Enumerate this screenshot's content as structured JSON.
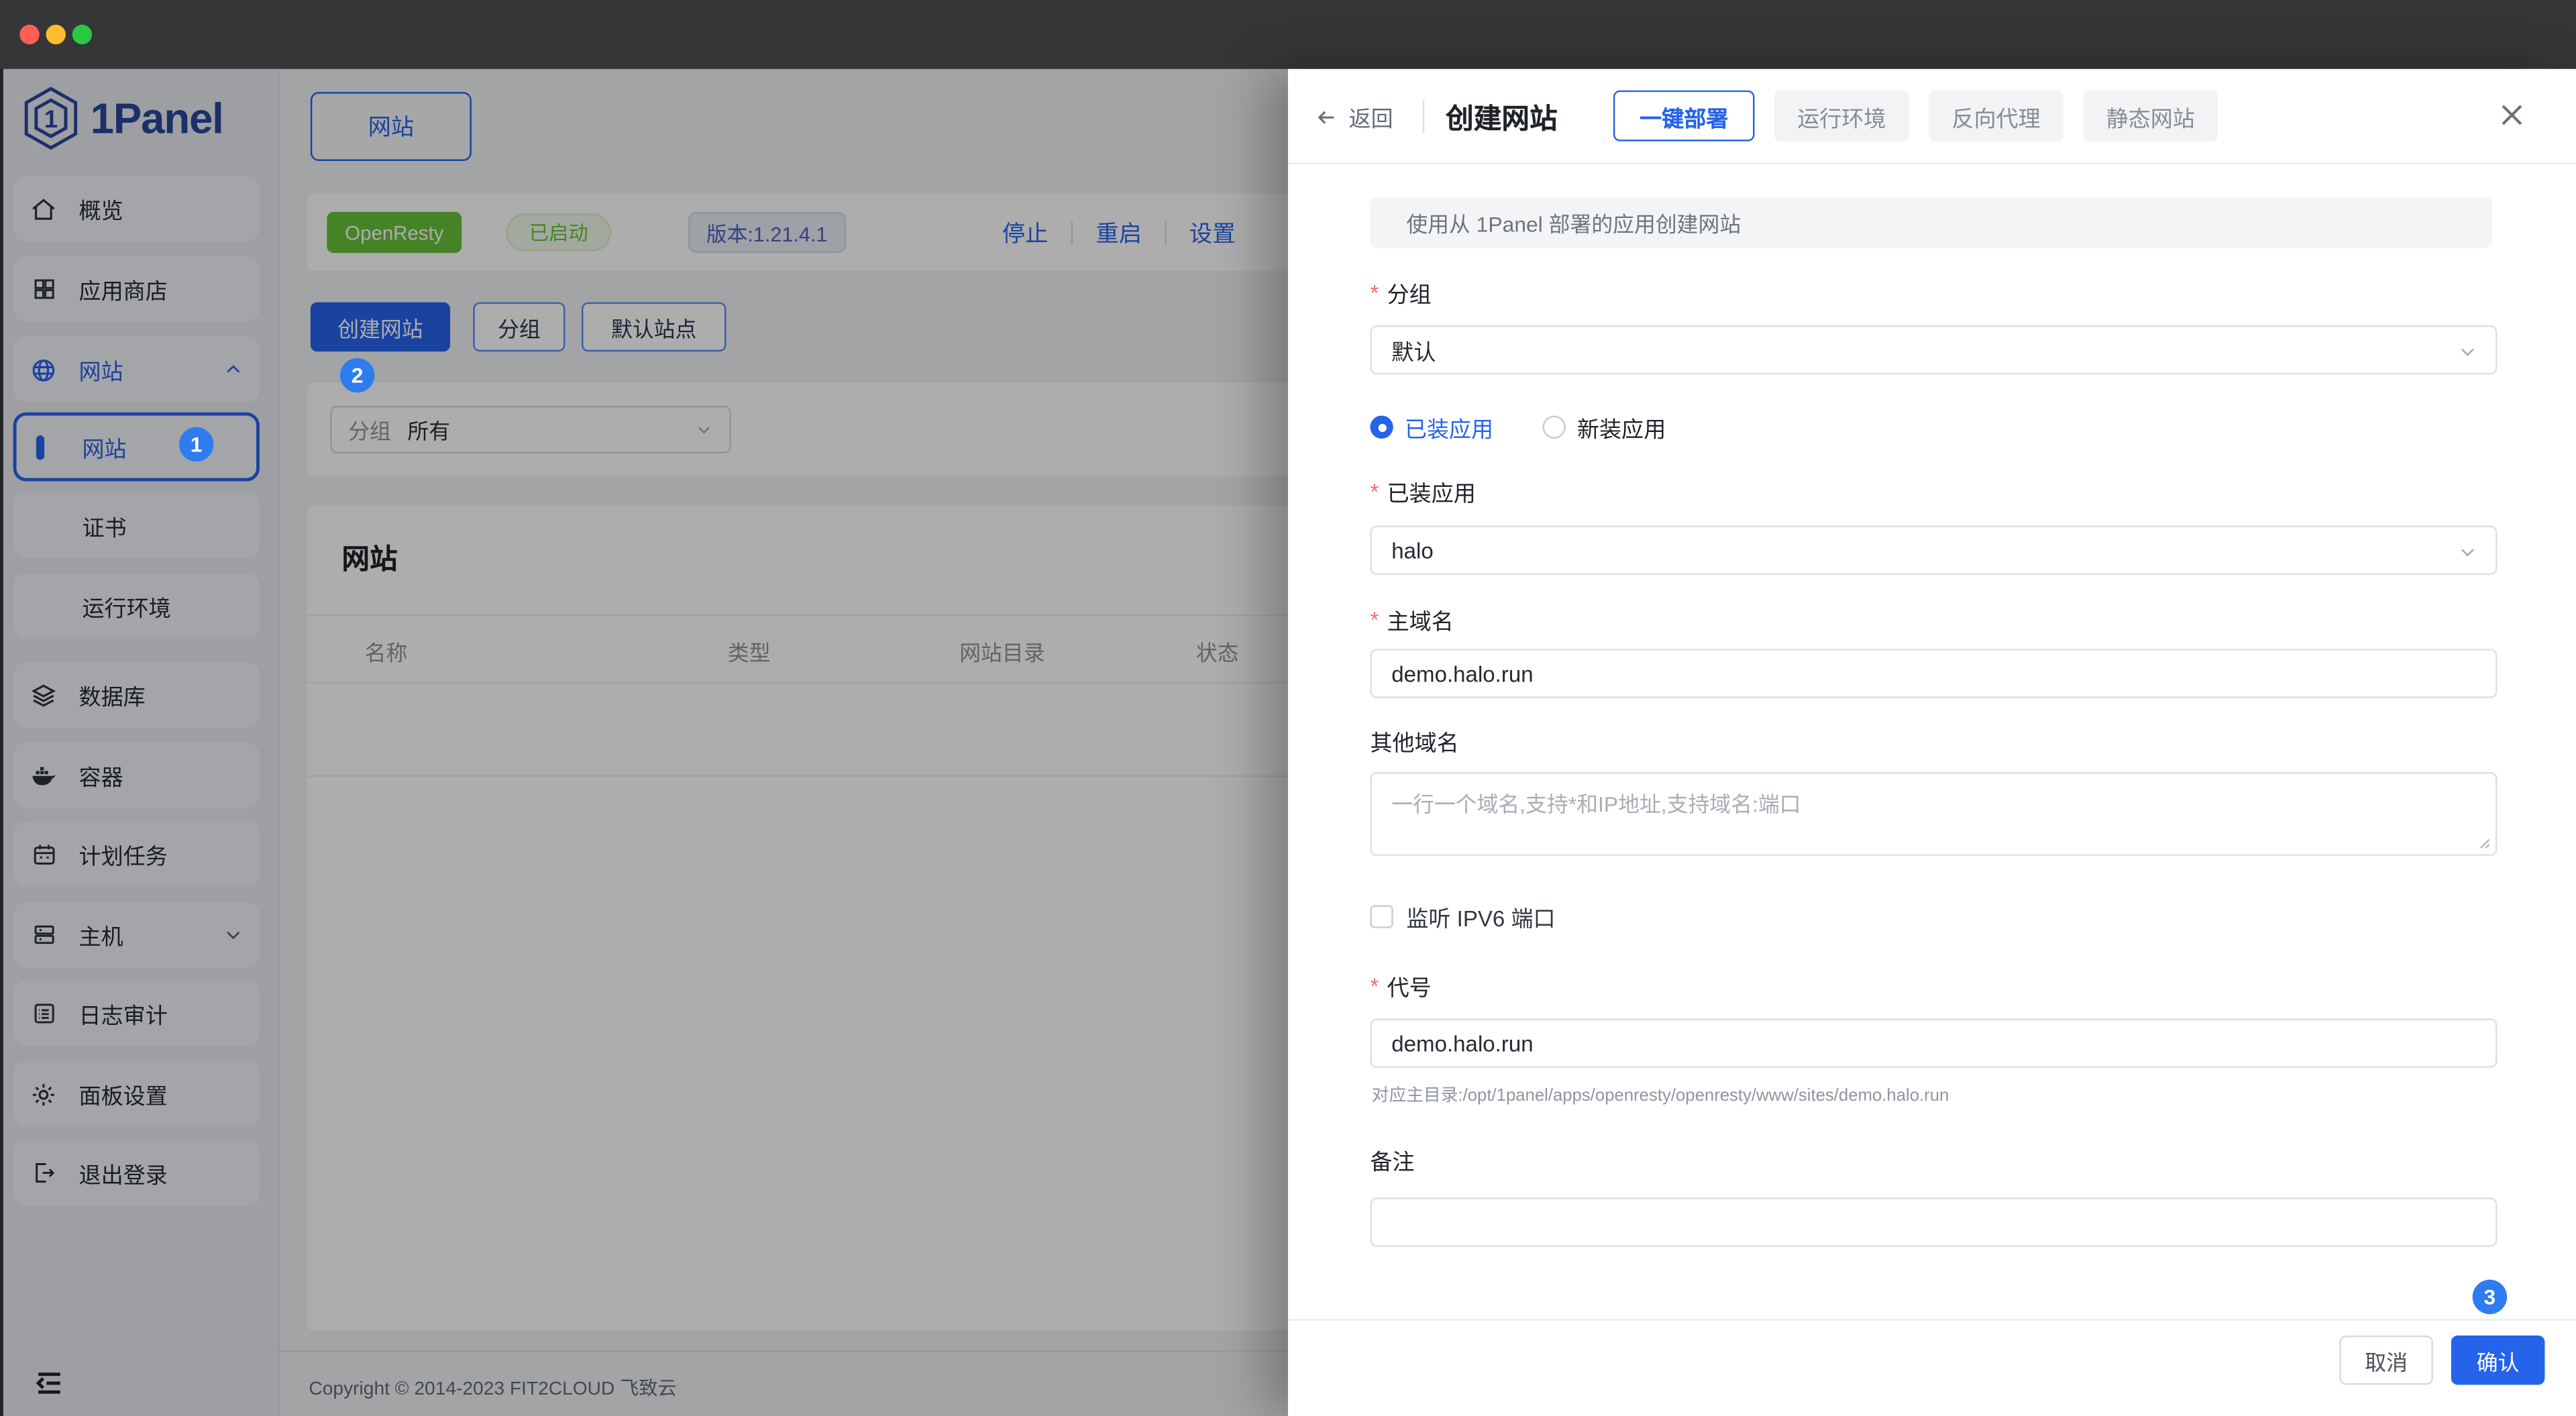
{
  "sidebar": {
    "logo_text": "1Panel",
    "items": [
      {
        "label": "概览",
        "icon": "home-icon"
      },
      {
        "label": "应用商店",
        "icon": "appstore-icon"
      },
      {
        "label": "网站",
        "icon": "globe-icon",
        "expanded": true
      },
      {
        "label": "网站",
        "active": true,
        "badge": "1"
      },
      {
        "label": "证书"
      },
      {
        "label": "运行环境"
      },
      {
        "label": "数据库",
        "icon": "database-icon"
      },
      {
        "label": "容器",
        "icon": "container-icon"
      },
      {
        "label": "计划任务",
        "icon": "calendar-icon"
      },
      {
        "label": "主机",
        "icon": "host-icon",
        "collapsible": true
      },
      {
        "label": "日志审计",
        "icon": "audit-icon"
      },
      {
        "label": "面板设置",
        "icon": "gear-icon"
      },
      {
        "label": "退出登录",
        "icon": "logout-icon"
      }
    ]
  },
  "main": {
    "tab_label": "网站",
    "runtime_card": {
      "name": "OpenResty",
      "status": "已启动",
      "version": "版本:1.21.4.1",
      "actions": [
        "停止",
        "重启",
        "设置"
      ]
    },
    "toolbar": {
      "create": "创建网站",
      "group": "分组",
      "default_site": "默认站点"
    },
    "filter": {
      "label": "分组",
      "value": "所有"
    },
    "site_table": {
      "title": "网站",
      "columns": [
        "名称",
        "类型",
        "网站目录",
        "状态"
      ]
    },
    "footer_text": "Copyright © 2014-2023 FIT2CLOUD 飞致云"
  },
  "drawer": {
    "back_label": "返回",
    "title": "创建网站",
    "tabs": [
      {
        "label": "一键部署",
        "active": true
      },
      {
        "label": "运行环境",
        "active": false
      },
      {
        "label": "反向代理",
        "active": false
      },
      {
        "label": "静态网站",
        "active": false
      }
    ],
    "info_text": "使用从 1Panel 部署的应用创建网站",
    "form": {
      "group": {
        "label": "分组",
        "required": true,
        "value": "默认"
      },
      "app_mode": {
        "options": [
          {
            "label": "已装应用",
            "selected": true
          },
          {
            "label": "新装应用",
            "selected": false
          }
        ]
      },
      "installed_app": {
        "label": "已装应用",
        "required": true,
        "value": "halo"
      },
      "primary_domain": {
        "label": "主域名",
        "required": true,
        "value": "demo.halo.run"
      },
      "other_domains": {
        "label": "其他域名",
        "placeholder": "一行一个域名,支持*和IP地址,支持域名:端口"
      },
      "ipv6": {
        "label": "监听 IPV6 端口",
        "checked": false
      },
      "code": {
        "label": "代号",
        "required": true,
        "value": "demo.halo.run",
        "helper": "对应主目录:/opt/1panel/apps/openresty/openresty/www/sites/demo.halo.run"
      },
      "remark": {
        "label": "备注",
        "value": ""
      }
    },
    "footer": {
      "cancel": "取消",
      "confirm": "确认"
    }
  },
  "annotations": {
    "step1": "1",
    "step2": "2",
    "step3": "3"
  },
  "colors": {
    "primary": "#2563eb",
    "success": "#67c23a",
    "annotation_blue": "#2f7cf0",
    "required_asterisk": "#f56c6c",
    "titlebar": "#353638"
  }
}
